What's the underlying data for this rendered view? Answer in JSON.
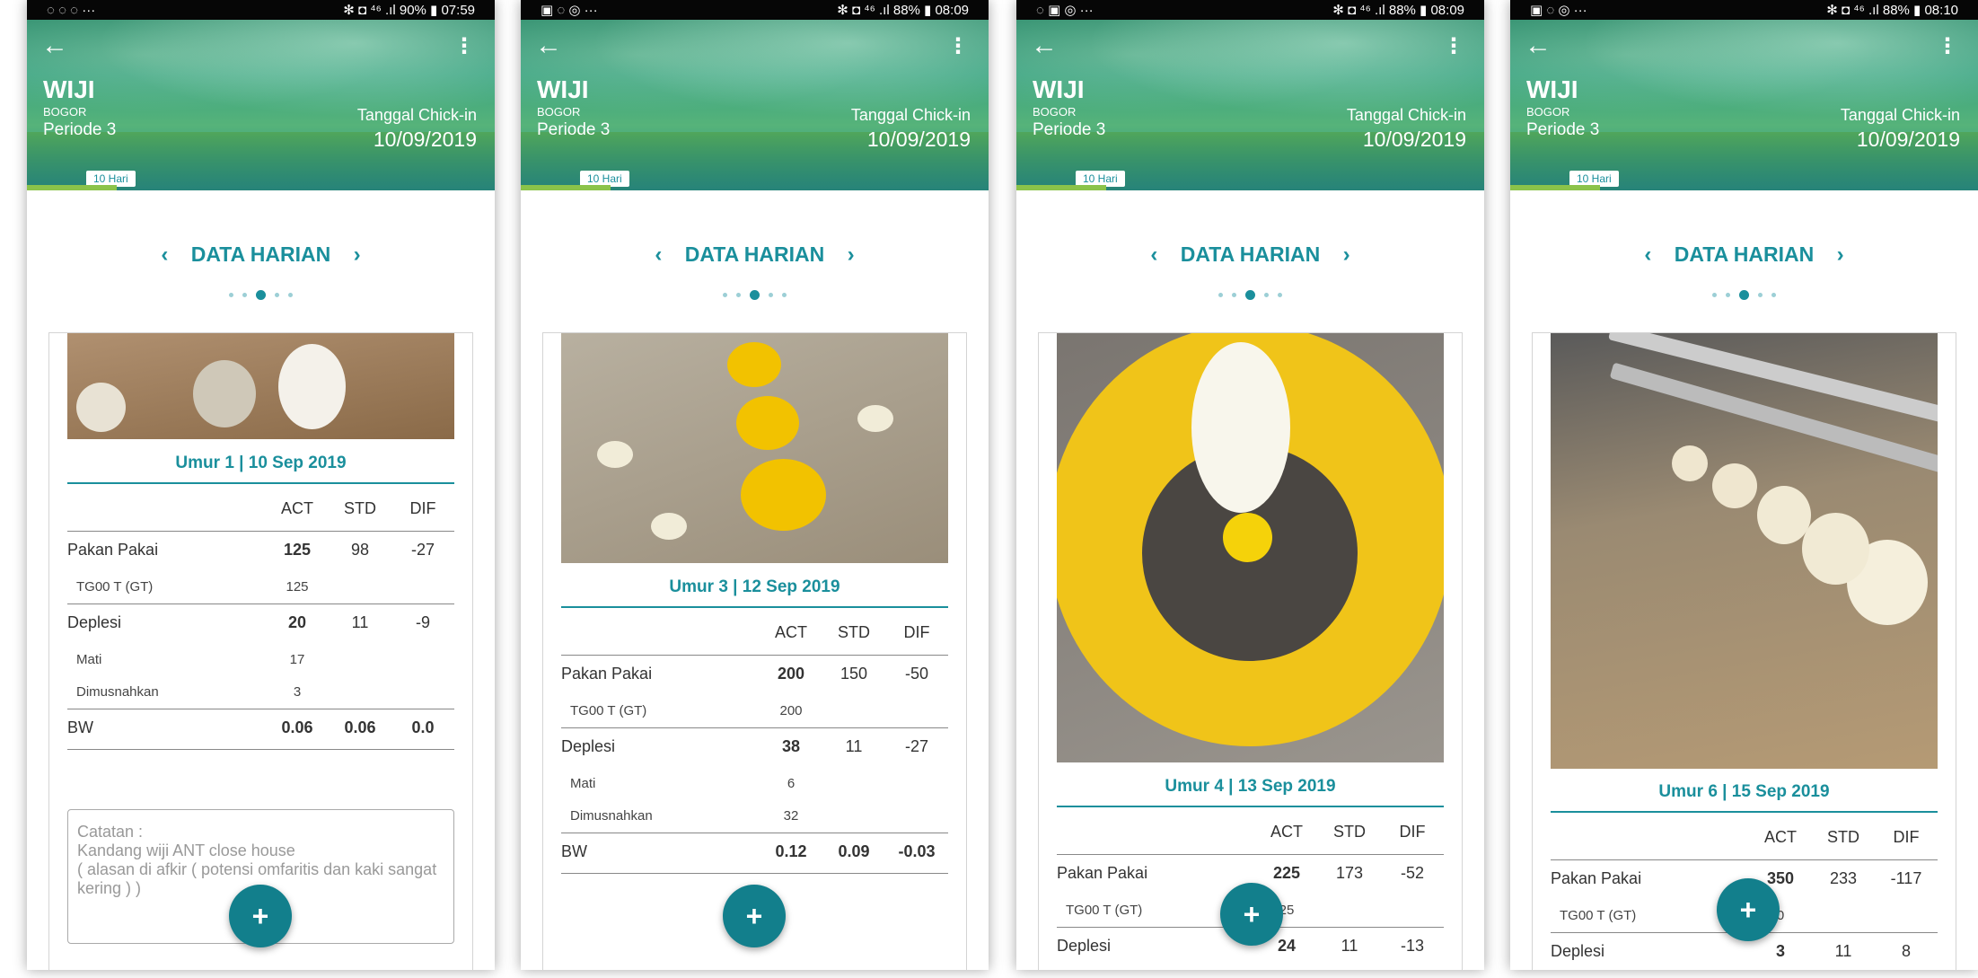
{
  "common": {
    "farm_name": "WIJI",
    "farm_location": "BOGOR",
    "periode": "Periode  3",
    "chick_in_label": "Tanggal Chick-in",
    "chick_in_date": "10/09/2019",
    "days_tag": "10 Hari",
    "section_title": "DATA HARIAN",
    "col_act": "ACT",
    "col_std": "STD",
    "col_dif": "DIF",
    "pakan_label": "Pakan Pakai",
    "feed_type_label": "TG00 T (GT)",
    "deplesi_label": "Deplesi",
    "mati_label": "Mati",
    "dimusnahkan_label": "Dimusnahkan",
    "bw_label": "BW",
    "fab_label": "+",
    "back_icon": "←",
    "menu_icon": "⋮",
    "prev_icon": "‹",
    "next_icon": "›"
  },
  "screens": [
    {
      "status": {
        "left": "◌ ◌ ◌ ···",
        "right": "✻ ◘ ⁴⁶ .ıl 90% ▮ 07:59"
      },
      "umur": "Umur 1 | 10 Sep 2019",
      "pakan": {
        "act": "125",
        "std": "98",
        "dif": "-27"
      },
      "feed_type_act": "125",
      "deplesi": {
        "act": "20",
        "std": "11",
        "dif": "-9"
      },
      "mati_act": "17",
      "dimusnahkan_act": "3",
      "bw": {
        "act": "0.06",
        "std": "0.06",
        "dif": "0.0"
      },
      "notes": "Catatan :\nKandang wiji ANT close house\n( alasan di afkir ( potensi omfaritis dan kaki sangat kering ) )"
    },
    {
      "status": {
        "left": "▣ ◌ ◎ ···",
        "right": "✻ ◘ ⁴⁶ .ıl 88% ▮ 08:09"
      },
      "umur": "Umur 3 | 12 Sep 2019",
      "pakan": {
        "act": "200",
        "std": "150",
        "dif": "-50"
      },
      "feed_type_act": "200",
      "deplesi": {
        "act": "38",
        "std": "11",
        "dif": "-27"
      },
      "mati_act": "6",
      "dimusnahkan_act": "32",
      "bw": {
        "act": "0.12",
        "std": "0.09",
        "dif": "-0.03"
      }
    },
    {
      "status": {
        "left": "◌ ▣ ◎ ···",
        "right": "✻ ◘ ⁴⁶ .ıl 88% ▮ 08:09"
      },
      "umur": "Umur 4 | 13 Sep 2019",
      "pakan": {
        "act": "225",
        "std": "173",
        "dif": "-52"
      },
      "feed_type_act": "25",
      "deplesi": {
        "act": "24",
        "std": "11",
        "dif": "-13"
      }
    },
    {
      "status": {
        "left": "▣ ◌ ◎ ···",
        "right": "✻ ◘ ⁴⁶ .ıl 88% ▮ 08:10"
      },
      "umur": "Umur 6 | 15 Sep 2019",
      "pakan": {
        "act": "350",
        "std": "233",
        "dif": "-117"
      },
      "feed_type_act": "0",
      "deplesi": {
        "act": "3",
        "std": "11",
        "dif": "8"
      }
    }
  ]
}
